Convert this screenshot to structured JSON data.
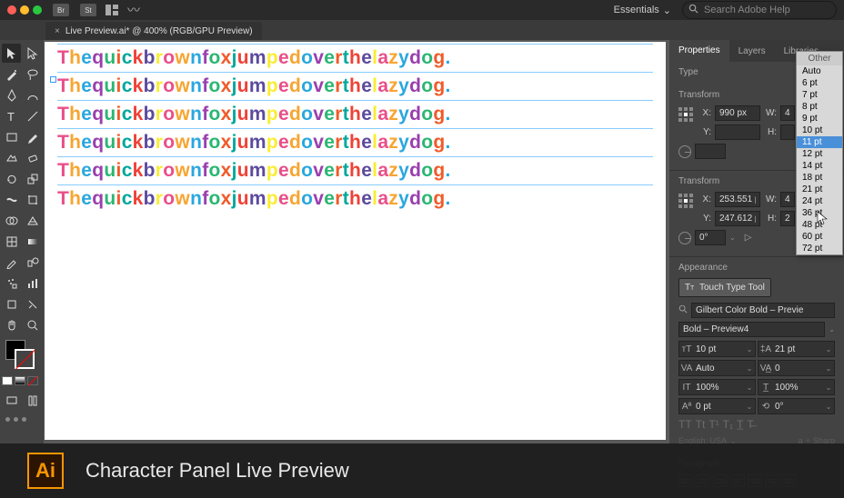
{
  "chrome": {
    "bridge_labels": [
      "Br",
      "St"
    ],
    "workspace": "Essentials",
    "search_placeholder": "Search Adobe Help"
  },
  "tab": {
    "title": "Live Preview.ai* @ 400% (RGB/GPU Preview)"
  },
  "canvas": {
    "pangram": "The quick brown fox jumped over the lazy dog.",
    "line_count": 6,
    "colors": [
      "#e94f8a",
      "#f7a531",
      "#2aa7df",
      "#9a3fae",
      "#2bb673",
      "#f15a29",
      "#00a79d",
      "#ef4136",
      "#5b4a9e",
      "#f9ed32"
    ]
  },
  "panel": {
    "tabs": [
      "Properties",
      "Layers",
      "Libraries"
    ],
    "type_label": "Type",
    "transform_label": "Transform",
    "appearance_label": "Appearance",
    "paragraph_label": "Paragraph",
    "t1": {
      "x": "990 px",
      "y": "",
      "w": "4",
      "h": ""
    },
    "t2": {
      "x": "253.551 p",
      "y": "247.612 p",
      "w": "4",
      "h": "2",
      "angle": "0°"
    },
    "touch_type": "Touch Type Tool",
    "font_name": "Gilbert Color Bold – Previe",
    "font_style": "Bold – Preview4",
    "char": {
      "size": "10 pt",
      "leading": "21 pt",
      "kerning": "Auto",
      "tracking": "0",
      "vscale": "100%",
      "hscale": "100%",
      "baseline": "0 pt",
      "rotation": "0°"
    },
    "lang": "English: USA",
    "aa": "Sharp"
  },
  "dropdown": {
    "header": "Other",
    "options": [
      "Auto",
      "6 pt",
      "7 pt",
      "8 pt",
      "9 pt",
      "10 pt",
      "11 pt",
      "12 pt",
      "14 pt",
      "18 pt",
      "21 pt",
      "24 pt",
      "36 pt",
      "48 pt",
      "60 pt",
      "72 pt"
    ],
    "highlighted": "11 pt"
  },
  "footer": {
    "logo": "Ai",
    "caption": "Character Panel Live Preview"
  }
}
